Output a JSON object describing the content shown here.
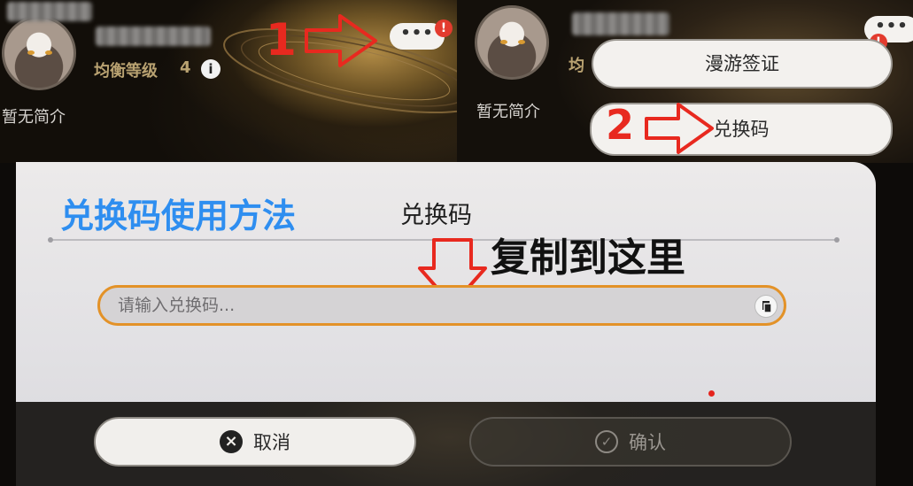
{
  "profile_left": {
    "level_label": "均衡等级",
    "level_value": "4",
    "info_icon_glyph": "i",
    "intro": "暂无简介",
    "more_button": "•••",
    "alert_badge": "!",
    "step_number": "1"
  },
  "profile_right": {
    "intro": "暂无简介",
    "partial_level_label": "均",
    "more_button": "•••",
    "alert_badge": "!",
    "menu": {
      "travel_visa": "漫游签证",
      "redeem_code": "兑换码"
    },
    "step_number": "2"
  },
  "dialog": {
    "help_title": "兑换码使用方法",
    "title": "兑换码",
    "paste_hint": "复制到这里",
    "input_placeholder": "请输入兑换码...",
    "cancel_label": "取消",
    "confirm_label": "确认"
  },
  "icons": {
    "info": "info-icon",
    "more": "more-dots-icon",
    "alert": "alert-badge-icon",
    "paste": "paste-icon",
    "cancel": "close-circle-icon",
    "confirm": "check-circle-icon",
    "arrow": "red-outline-arrow-icon"
  },
  "colors": {
    "annotation_red": "#e8291f",
    "title_blue": "#2e8ef0",
    "input_border_orange": "#e39228",
    "level_gold": "#b9a271"
  }
}
